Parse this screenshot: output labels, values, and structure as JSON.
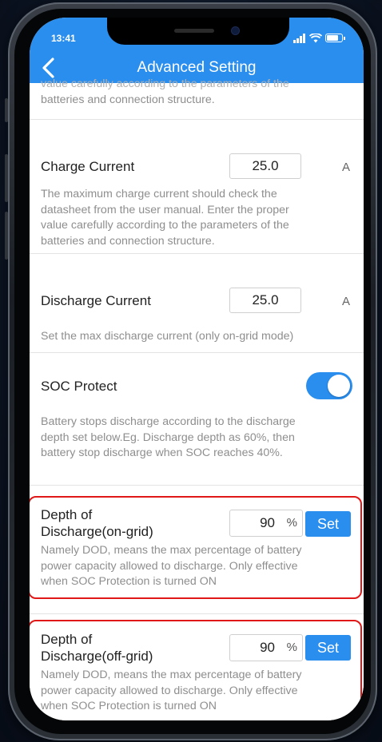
{
  "status_bar": {
    "time": "13:41"
  },
  "header": {
    "title": "Advanced Setting",
    "back_icon": "chevron-left-icon",
    "color": "#2a8eef"
  },
  "top_partial": {
    "line1": "value carefully according to the parameters of the",
    "line2": "batteries and connection structure."
  },
  "charge_current": {
    "label": "Charge Current",
    "value": "25.0",
    "unit": "A",
    "desc": [
      "The maximum charge current should check the",
      "datasheet from the user manual. Enter the proper",
      "value carefully according to the parameters of the",
      "batteries and connection structure."
    ]
  },
  "discharge_current": {
    "label": "Discharge Current",
    "value": "25.0",
    "unit": "A",
    "desc": "Set the max discharge current (only on-grid mode)"
  },
  "soc_protect": {
    "label": "SOC Protect",
    "enabled": true,
    "desc": [
      "Battery stops discharge according to the discharge",
      "depth set below.Eg. Discharge depth as 60%, then",
      "battery stop discharge when SOC reaches 40%."
    ]
  },
  "dod_on_grid": {
    "label_line1": "Depth of",
    "label_line2": "Discharge(on-grid)",
    "value": "90",
    "unit": "%",
    "button": "Set",
    "desc": [
      "Namely DOD, means the max percentage of battery",
      "power capacity allowed to discharge. Only effective",
      "when SOC Protection is turned ON"
    ]
  },
  "dod_off_grid": {
    "label_line1": "Depth of",
    "label_line2": "Discharge(off-grid)",
    "value": "90",
    "unit": "%",
    "button": "Set",
    "desc": [
      "Namely DOD, means the max percentage of battery",
      "power capacity allowed to discharge. Only effective",
      "when SOC Protection is turned ON"
    ]
  },
  "colors": {
    "accent": "#2a8eef",
    "highlight": "#e01818"
  }
}
